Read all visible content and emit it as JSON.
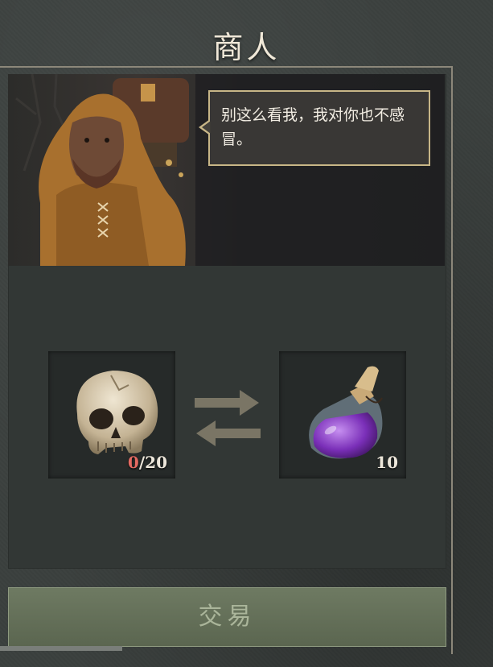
{
  "header": {
    "title": "商人"
  },
  "dialog": {
    "text": "别这么看我，我对你也不感冒。"
  },
  "trade": {
    "give": {
      "icon": "skull-icon",
      "have": "0",
      "separator": "/",
      "need": "20"
    },
    "receive": {
      "icon": "purple-potion-icon",
      "amount": "10"
    },
    "exchange_icon": "exchange-arrows-icon"
  },
  "action": {
    "trade_label": "交易"
  },
  "colors": {
    "accent_gold": "#c8b687",
    "insufficient_red": "#e46a62",
    "button_green": "#6e7a62",
    "button_text": "#aab59a"
  }
}
